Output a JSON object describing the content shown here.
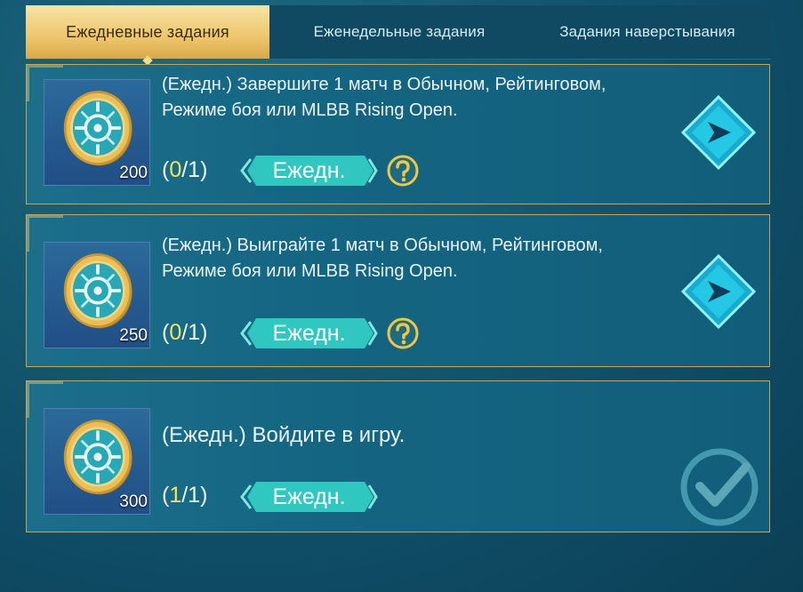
{
  "tabs": [
    {
      "label": "Ежедневные задания",
      "active": true
    },
    {
      "label": "Еженедельные задания",
      "active": false
    },
    {
      "label": "Задания наверстывания",
      "active": false
    }
  ],
  "quests": [
    {
      "reward": "200",
      "description": "(Ежедн.) Завершите 1 матч в Обычном, Рейтинговом, Режиме боя или MLBB Rising Open.",
      "progress_open": "(",
      "progress_current": "0",
      "progress_total": "/1)",
      "type_label": "Ежедн.",
      "completed": false
    },
    {
      "reward": "250",
      "description": "(Ежедн.) Выиграйте 1 матч в Обычном, Рейтинговом, Режиме боя или MLBB Rising Open.",
      "progress_open": "(",
      "progress_current": "0",
      "progress_total": "/1)",
      "type_label": "Ежедн.",
      "completed": false
    },
    {
      "reward": "300",
      "description": "(Ежедн.) Войдите в игру.",
      "progress_open": "(",
      "progress_current": "1",
      "progress_total": "/1)",
      "type_label": "Ежедн.",
      "completed": true
    }
  ],
  "colors": {
    "accent_gold": "#e0c277",
    "progress_current": "#f5e35a",
    "badge_teal": "#2fc7c0",
    "go_button": "#21c6e0"
  },
  "icons": {
    "reward": "gold-emblem-coin-icon",
    "help": "question-mark-icon",
    "go": "arrow-right-diamond-icon",
    "done": "checkmark-circle-icon"
  }
}
